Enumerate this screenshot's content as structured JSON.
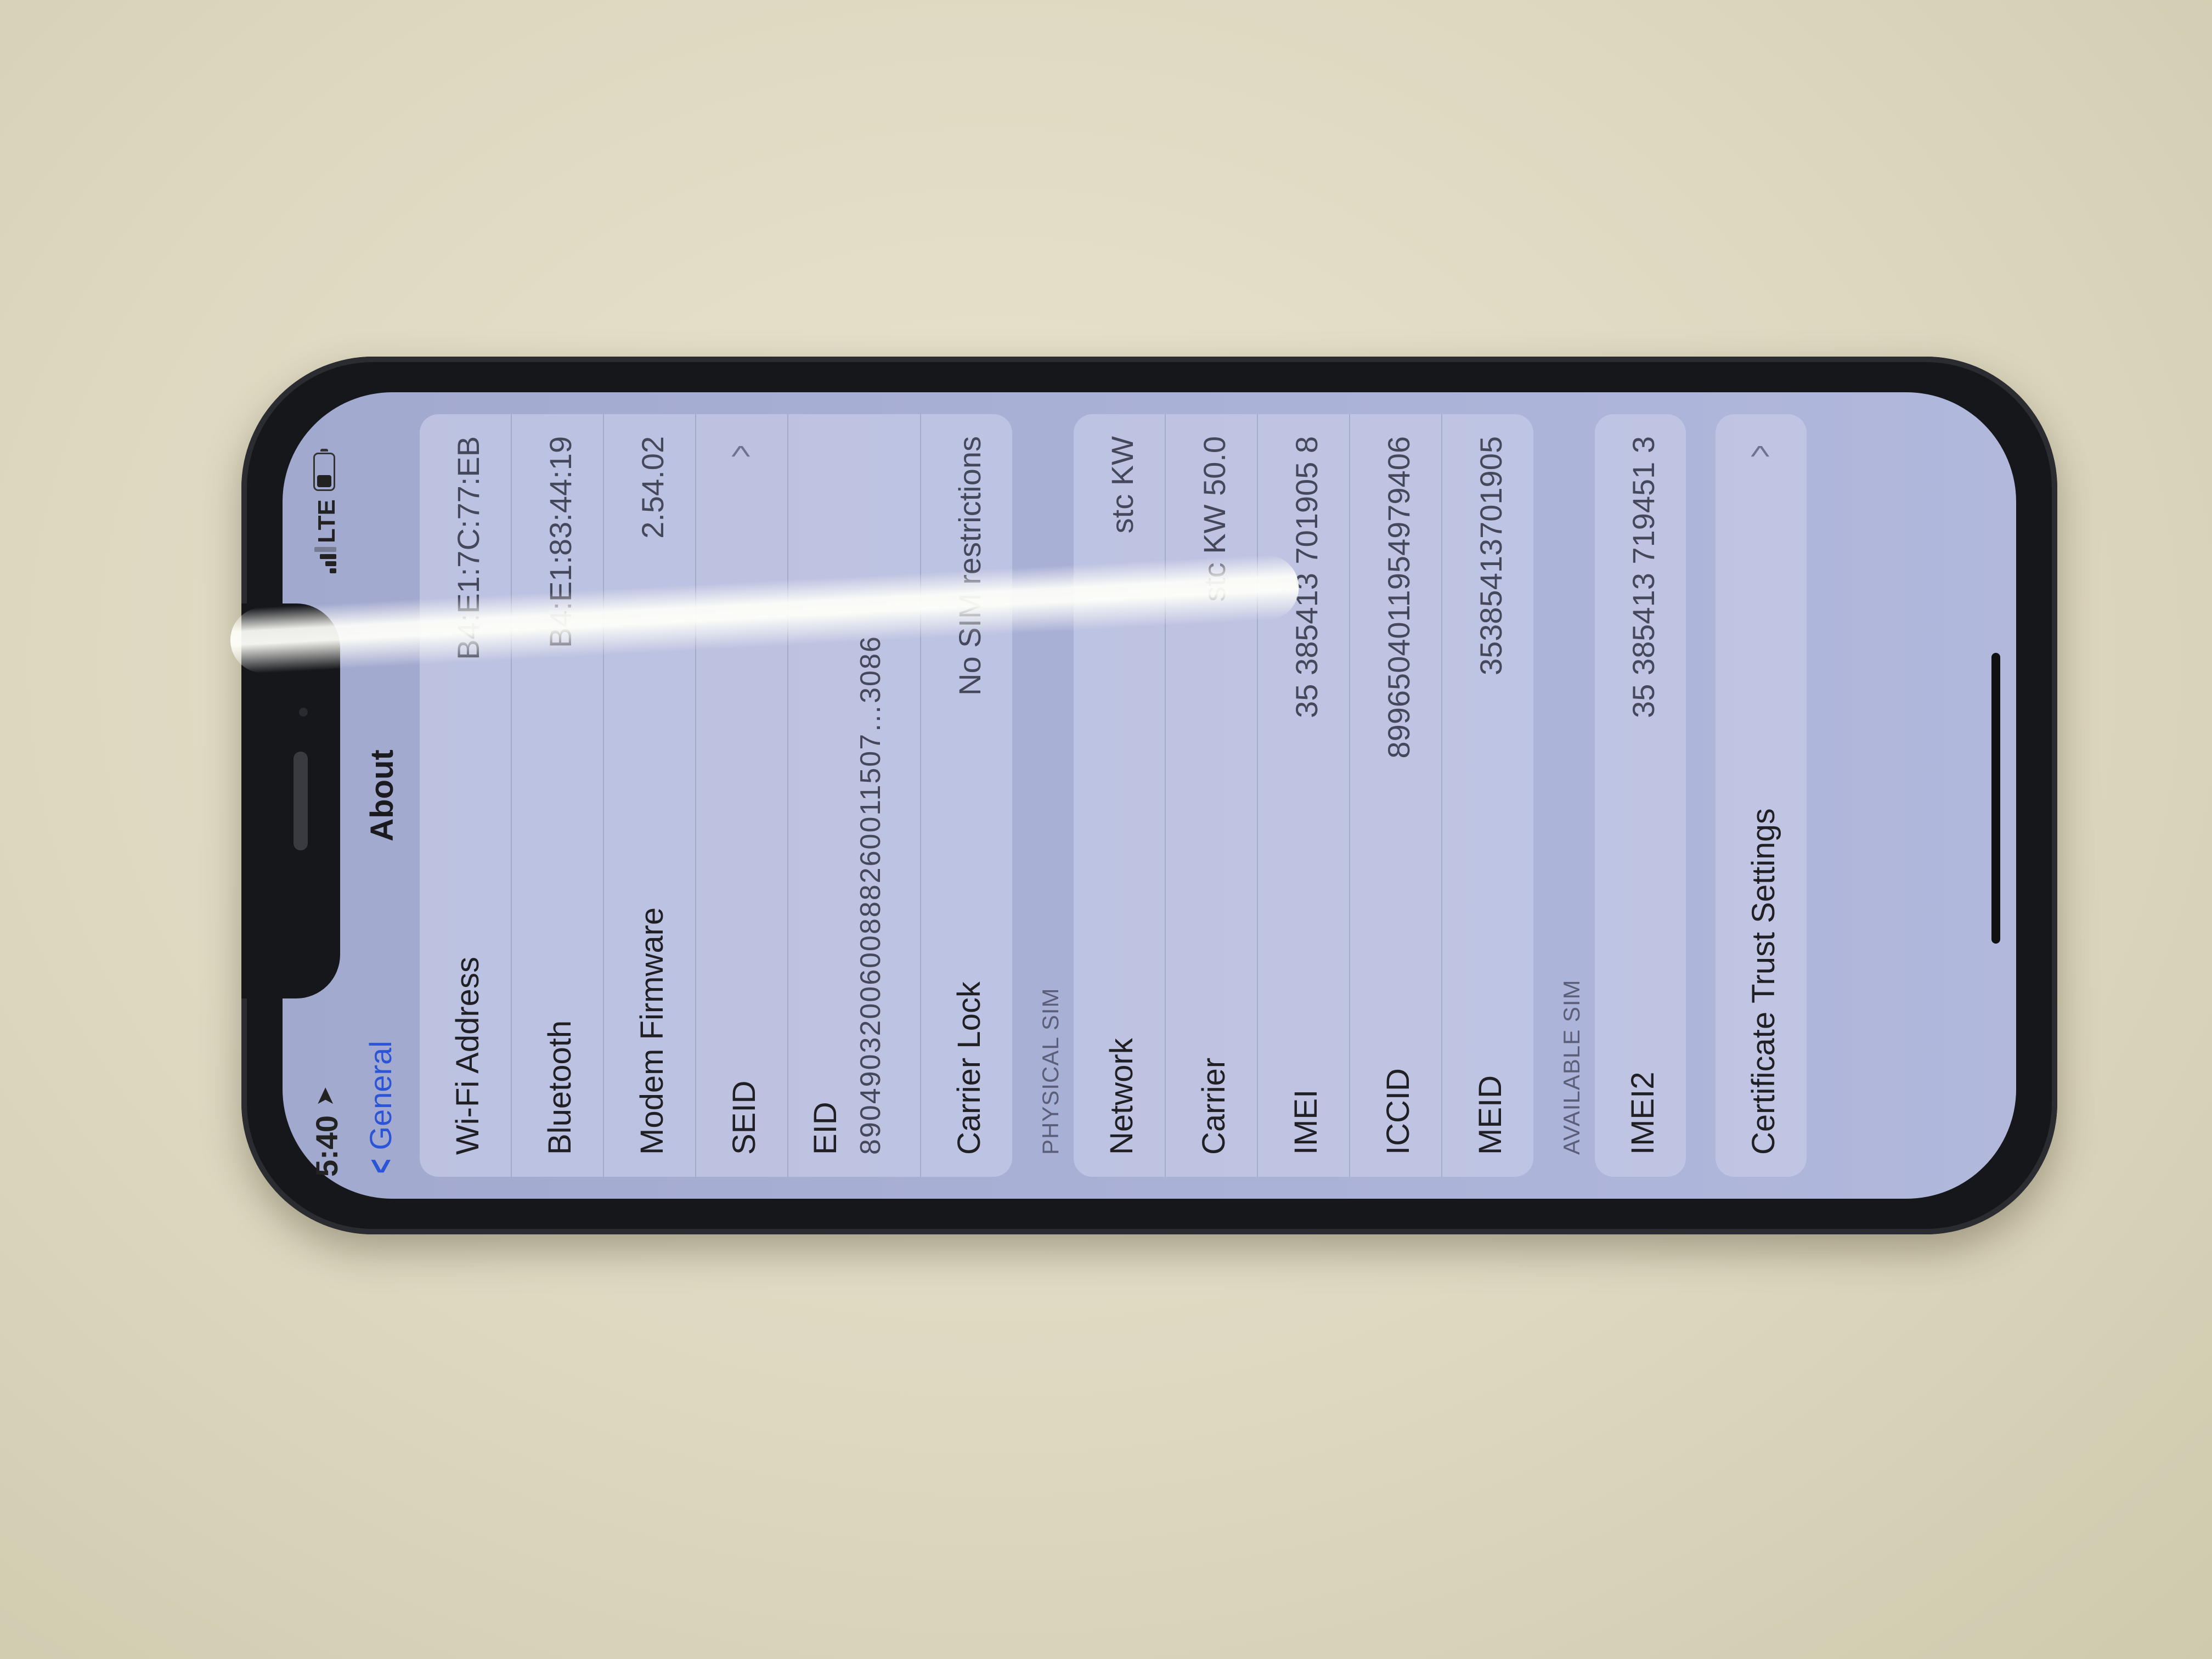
{
  "status_bar": {
    "time": "5:40",
    "network": "LTE",
    "location_icon": "location-arrow-icon",
    "signal_icon": "signal-bars-icon",
    "battery_icon": "battery-icon"
  },
  "nav": {
    "back_label": "General",
    "title": "About"
  },
  "general_rows": [
    {
      "label": "Wi-Fi Address",
      "value": "B4:E1:7C:77:EB"
    },
    {
      "label": "Bluetooth",
      "value": "B4:E1:83:44:19"
    },
    {
      "label": "Modem Firmware",
      "value": "2.54.02"
    },
    {
      "label": "SEID",
      "value": ""
    },
    {
      "label": "EID",
      "value": "8904903200600888260011507…3086"
    },
    {
      "label": "Carrier Lock",
      "value": "No SIM restrictions"
    }
  ],
  "physical_sim": {
    "header": "PHYSICAL SIM",
    "rows": [
      {
        "label": "Network",
        "value": "stc KW"
      },
      {
        "label": "Carrier",
        "value": "stc KW 50.0"
      },
      {
        "label": "IMEI",
        "value": "35 385413 701905 8"
      },
      {
        "label": "ICCID",
        "value": "8996504011954979406"
      },
      {
        "label": "MEID",
        "value": "35385413701905"
      }
    ]
  },
  "available_sim": {
    "header": "AVAILABLE SIM",
    "rows": [
      {
        "label": "IMEI2",
        "value": "35 385413 719451 3"
      }
    ]
  },
  "certificate": {
    "label": "Certificate Trust Settings"
  },
  "colors": {
    "accent": "#2b55d6",
    "screen_tint": "#a9b0d6",
    "table_surface": "#dcd7bf",
    "phone_frame": "#16171b"
  }
}
